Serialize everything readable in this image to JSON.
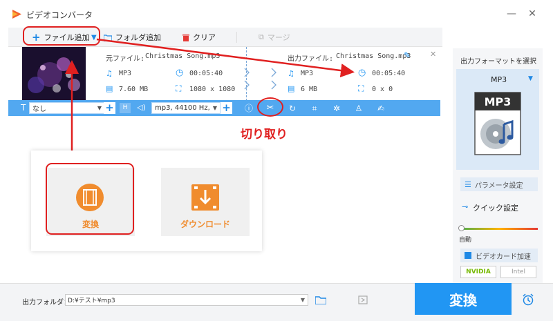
{
  "window": {
    "title": "ビデオコンバータ",
    "minimize": "—",
    "close": "✕"
  },
  "toolbar": {
    "add_file": "ファイル追加",
    "add_folder": "フォルダ追加",
    "clear": "クリア",
    "merge": "マージ"
  },
  "file": {
    "source_label": "元ファイル:",
    "source_name": "Christmas Song.mp3",
    "output_label": "出力ファイル:",
    "output_name": "Christmas Song.mp3",
    "src_format": "MP3",
    "src_duration": "00:05:40",
    "src_size": "7.60 MB",
    "src_resolution": "1080 x 1080",
    "out_format": "MP3",
    "out_duration": "00:05:40",
    "out_size": "6 MB",
    "out_resolution": "0 x 0"
  },
  "strip": {
    "subtitle": "なし",
    "audio": "mp3, 44100 Hz,",
    "h_label": "H"
  },
  "annotations": {
    "cut_label": "切り取り"
  },
  "card": {
    "convert_tile": "変換",
    "download_tile": "ダウンロード"
  },
  "right_panel": {
    "output_format_title": "出力フォーマットを選択",
    "selected_format": "MP3",
    "format_icon_text": "MP3",
    "param_settings": "パラメータ設定",
    "quick_settings": "クイック設定",
    "quick_auto": "自動",
    "gpu_accel": "ビデオカード加速",
    "nvidia": "NVIDIA",
    "intel": "Intel"
  },
  "footer": {
    "output_folder_label": "出力フォルダ：",
    "output_folder_value": "D:¥テスト¥mp3",
    "convert_button": "変換"
  },
  "colors": {
    "accent": "#2196f3",
    "annotation_red": "#e02020",
    "tile_orange": "#f08c2e"
  }
}
